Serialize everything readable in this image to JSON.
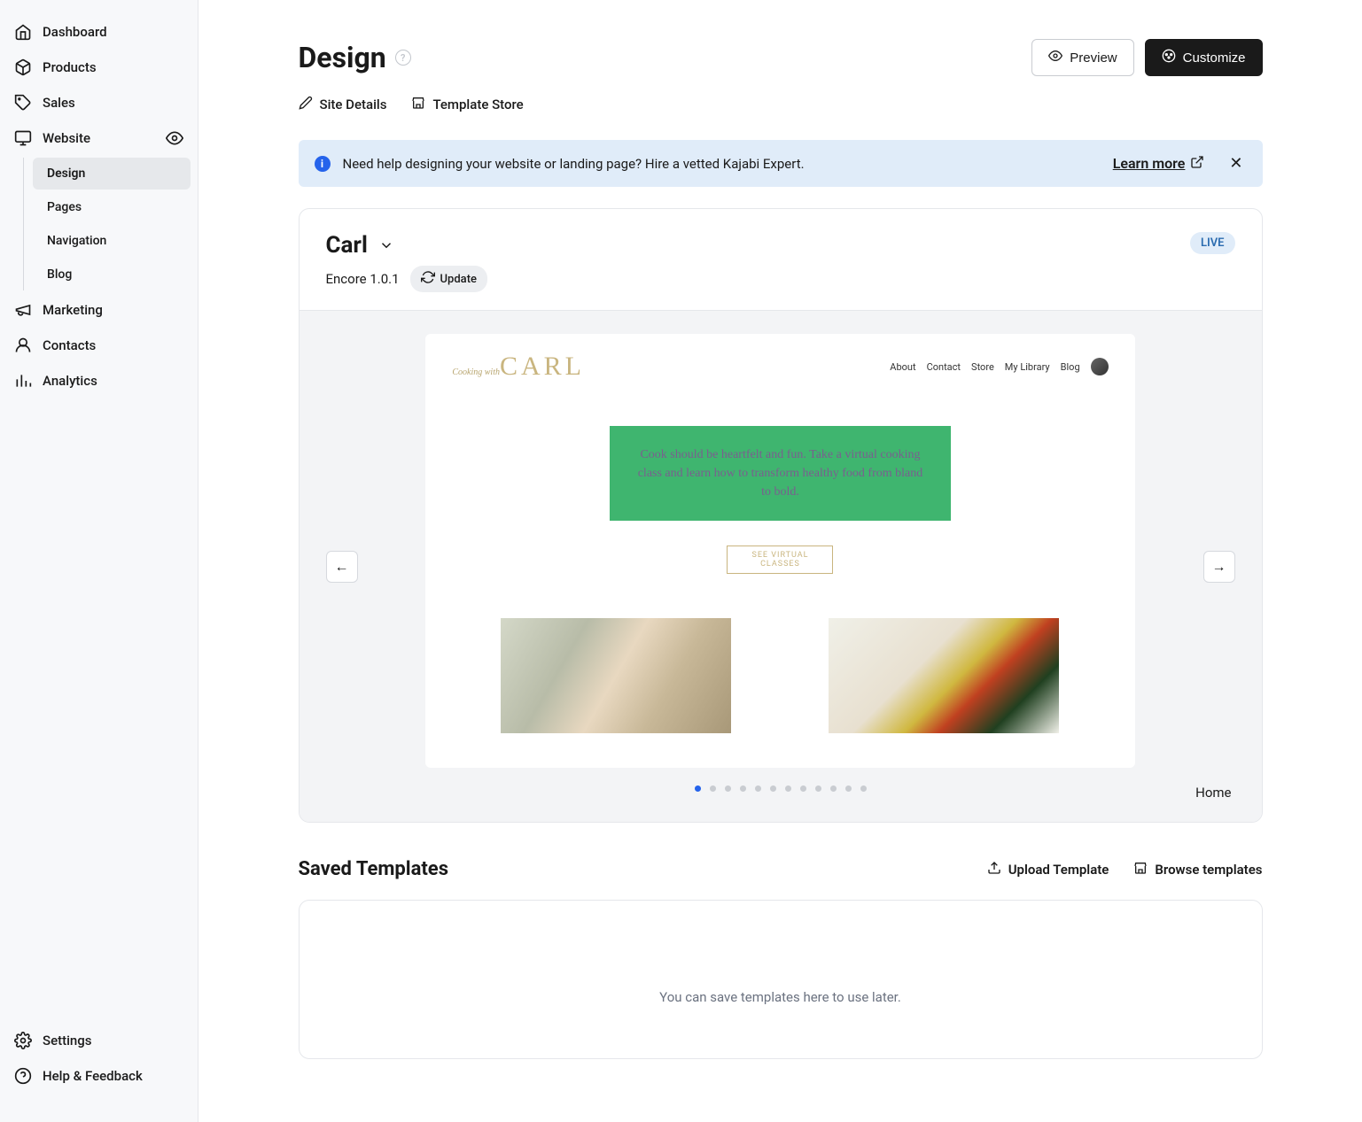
{
  "sidebar": {
    "items": [
      {
        "label": "Dashboard"
      },
      {
        "label": "Products"
      },
      {
        "label": "Sales"
      },
      {
        "label": "Website"
      },
      {
        "label": "Marketing"
      },
      {
        "label": "Contacts"
      },
      {
        "label": "Analytics"
      }
    ],
    "sub_items": [
      {
        "label": "Design"
      },
      {
        "label": "Pages"
      },
      {
        "label": "Navigation"
      },
      {
        "label": "Blog"
      }
    ],
    "bottom": [
      {
        "label": "Settings"
      },
      {
        "label": "Help & Feedback"
      }
    ]
  },
  "header": {
    "title": "Design",
    "preview": "Preview",
    "customize": "Customize"
  },
  "subnav": {
    "site_details": "Site Details",
    "template_store": "Template Store"
  },
  "banner": {
    "text": "Need help designing your website or landing page? Hire a vetted Kajabi Expert.",
    "learn_more": "Learn more"
  },
  "site": {
    "name": "Carl",
    "version": "Encore 1.0.1",
    "update": "Update",
    "status": "LIVE",
    "page_label": "Home"
  },
  "preview": {
    "logo_small": "Cooking with",
    "logo_big": "CARL",
    "nav": [
      "About",
      "Contact",
      "Store",
      "My Library",
      "Blog"
    ],
    "hero": "Cook should be heartfelt and fun. Take a virtual cooking class and learn how to transform healthy food from bland to bold.",
    "cta": "SEE VIRTUAL CLASSES"
  },
  "templates": {
    "title": "Saved Templates",
    "upload": "Upload Template",
    "browse": "Browse templates",
    "empty": "You can save templates here to use later."
  }
}
